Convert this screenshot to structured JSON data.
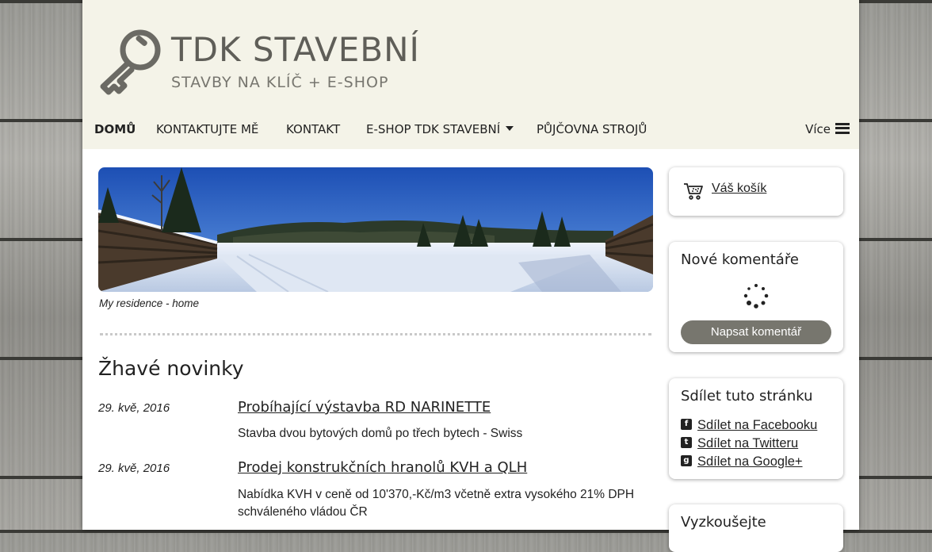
{
  "site": {
    "title": "TDK STAVEBNÍ",
    "subtitle": "STAVBY NA KLÍČ + E-SHOP"
  },
  "nav": {
    "items": [
      {
        "label": "DOMŮ",
        "active": true
      },
      {
        "label": "KONTAKTUJTE MĚ"
      },
      {
        "label": "KONTAKT"
      },
      {
        "label": "E-SHOP TDK STAVEBNÍ",
        "dropdown": true
      },
      {
        "label": "PŮJČOVNA STROJŮ"
      }
    ],
    "more_label": "Více"
  },
  "banner": {
    "caption": "My residence - home"
  },
  "news": {
    "heading": "Žhavé novinky",
    "items": [
      {
        "date": "29. kvě, 2016",
        "title": "Probíhající výstavba RD NARINETTE",
        "desc": "Stavba dvou bytových domů po třech bytech - Swiss"
      },
      {
        "date": "29. kvě, 2016",
        "title": "Prodej konstrukčních hranolů KVH a QLH",
        "desc_line1": "Nabídka KVH v ceně od 10'370,-Kč/m3 včetně extra vysokého 21% DPH",
        "desc_line2": "schváleného vládou ČR"
      }
    ]
  },
  "sidebar": {
    "cart_label": "Váš košík",
    "comments_title": "Nové komentáře",
    "comments_button": "Napsat komentář",
    "share_title": "Sdílet tuto stránku",
    "share_items": [
      {
        "label": "Sdílet na Facebooku",
        "icon": "facebook-icon"
      },
      {
        "label": "Sdílet na Twitteru",
        "icon": "twitter-icon"
      },
      {
        "label": "Sdílet na Google+",
        "icon": "google-plus-icon"
      }
    ],
    "try_title": "Vyzkoušejte"
  },
  "colors": {
    "header_bg": "#f4f3e8",
    "title_text": "#5f5e58",
    "button_bg": "#77766e"
  }
}
